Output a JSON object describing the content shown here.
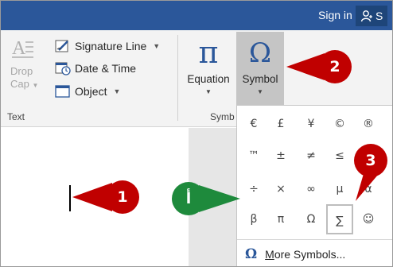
{
  "titlebar": {
    "signin": "Sign in",
    "share_label": "S"
  },
  "ribbon": {
    "text_group": {
      "label": "Text",
      "dropcap_line1": "Drop",
      "dropcap_line2": "Cap",
      "signature_line": "Signature Line",
      "date_time": "Date & Time",
      "object": "Object"
    },
    "symbols_group": {
      "label": "Symb",
      "equation_icon": "π",
      "equation": "Equation",
      "symbol_icon": "Ω",
      "symbol": "Symbol"
    }
  },
  "gallery": {
    "rows": [
      [
        "€",
        "£",
        "¥",
        "©",
        "®"
      ],
      [
        "™",
        "±",
        "≠",
        "≤",
        "≥"
      ],
      [
        "÷",
        "×",
        "∞",
        "µ",
        "α"
      ],
      [
        "β",
        "π",
        "Ω",
        "∑",
        "☺"
      ]
    ],
    "selected": "∑",
    "more_icon": "Ω",
    "more_first": "M",
    "more_rest": "ore Symbols..."
  },
  "callouts": [
    {
      "label": "1",
      "color": "#c00000"
    },
    {
      "label": "2",
      "color": "#c00000"
    },
    {
      "label": "3",
      "color": "#c00000"
    },
    {
      "label": "أ",
      "color": "#1e8a3c"
    }
  ],
  "colors": {
    "titlebar": "#2b579a",
    "ribbon": "#f3f3f3",
    "accent": "#2b579a"
  }
}
